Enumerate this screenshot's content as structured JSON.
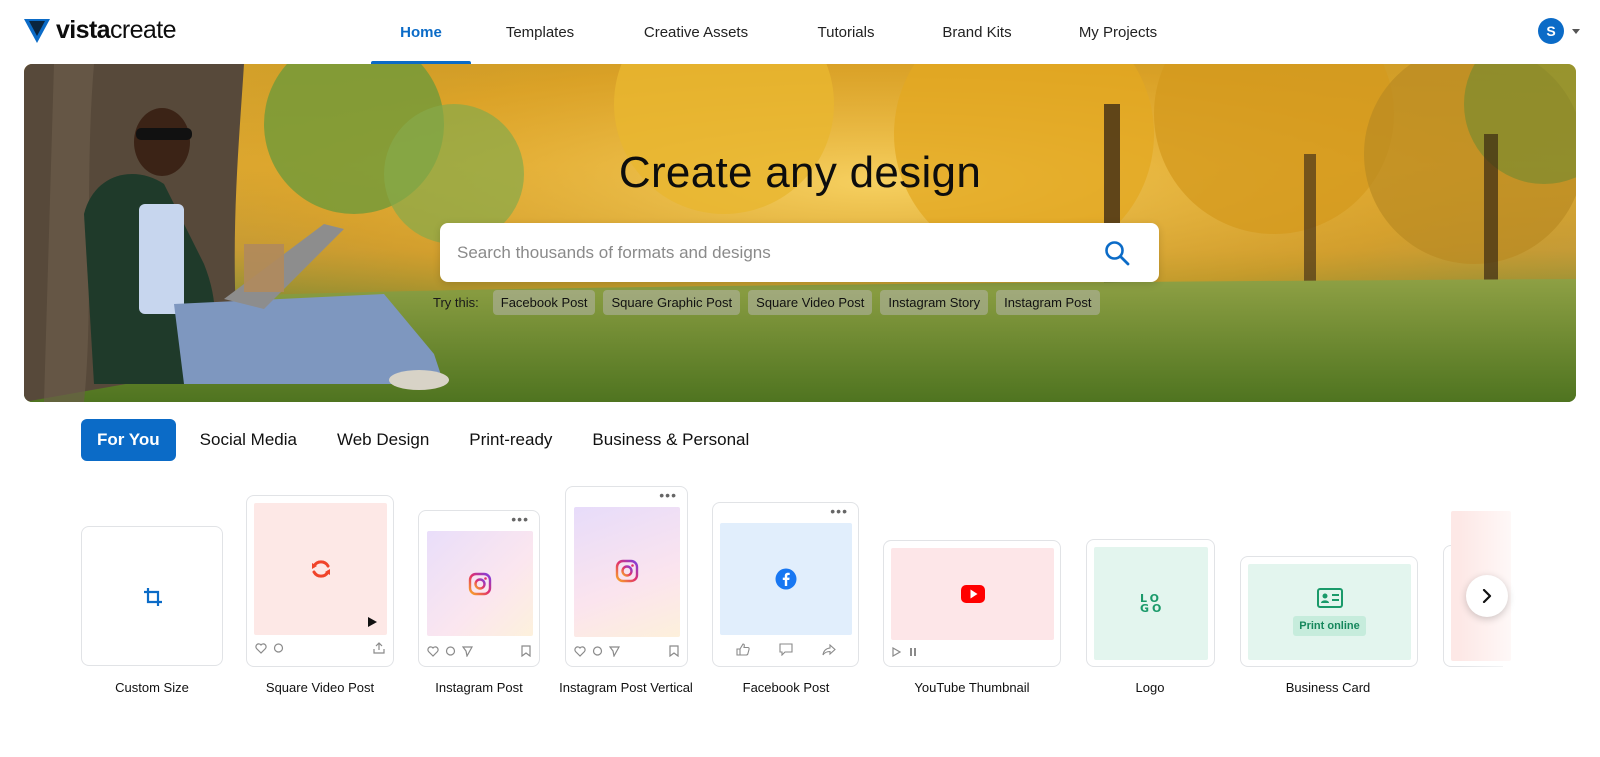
{
  "header": {
    "logo_bold": "vista",
    "logo_light": "create",
    "nav": [
      {
        "label": "Home",
        "active": true
      },
      {
        "label": "Templates",
        "active": false
      },
      {
        "label": "Creative Assets",
        "active": false
      },
      {
        "label": "Tutorials",
        "active": false
      },
      {
        "label": "Brand Kits",
        "active": false
      },
      {
        "label": "My Projects",
        "active": false
      }
    ],
    "avatar_initial": "S"
  },
  "hero": {
    "title": "Create any design",
    "search_placeholder": "Search thousands of formats and designs",
    "search_value": "",
    "try_label": "Try this:",
    "suggestions": [
      "Facebook Post",
      "Square Graphic Post",
      "Square Video Post",
      "Instagram Story",
      "Instagram Post"
    ]
  },
  "categories": {
    "tabs": [
      "For You",
      "Social Media",
      "Web Design",
      "Print-ready",
      "Business & Personal"
    ],
    "active": "For You"
  },
  "cards": [
    {
      "label": "Custom Size",
      "icon": "crop-icon"
    },
    {
      "label": "Square Video Post",
      "icon": "video-loop-icon"
    },
    {
      "label": "Instagram Post",
      "icon": "instagram-icon"
    },
    {
      "label": "Instagram Post Vertical",
      "icon": "instagram-icon"
    },
    {
      "label": "Facebook Post",
      "icon": "facebook-icon"
    },
    {
      "label": "YouTube Thumbnail",
      "icon": "youtube-icon"
    },
    {
      "label": "Logo",
      "icon": "logo-icon",
      "logo_text": "LO GO"
    },
    {
      "label": "Business Card",
      "icon": "id-card-icon",
      "badge": "Print online"
    }
  ],
  "colors": {
    "accent": "#0b6bc7",
    "facebook": "#1877f2",
    "youtube": "#ff0000",
    "logo_green": "#1a9a6a"
  }
}
